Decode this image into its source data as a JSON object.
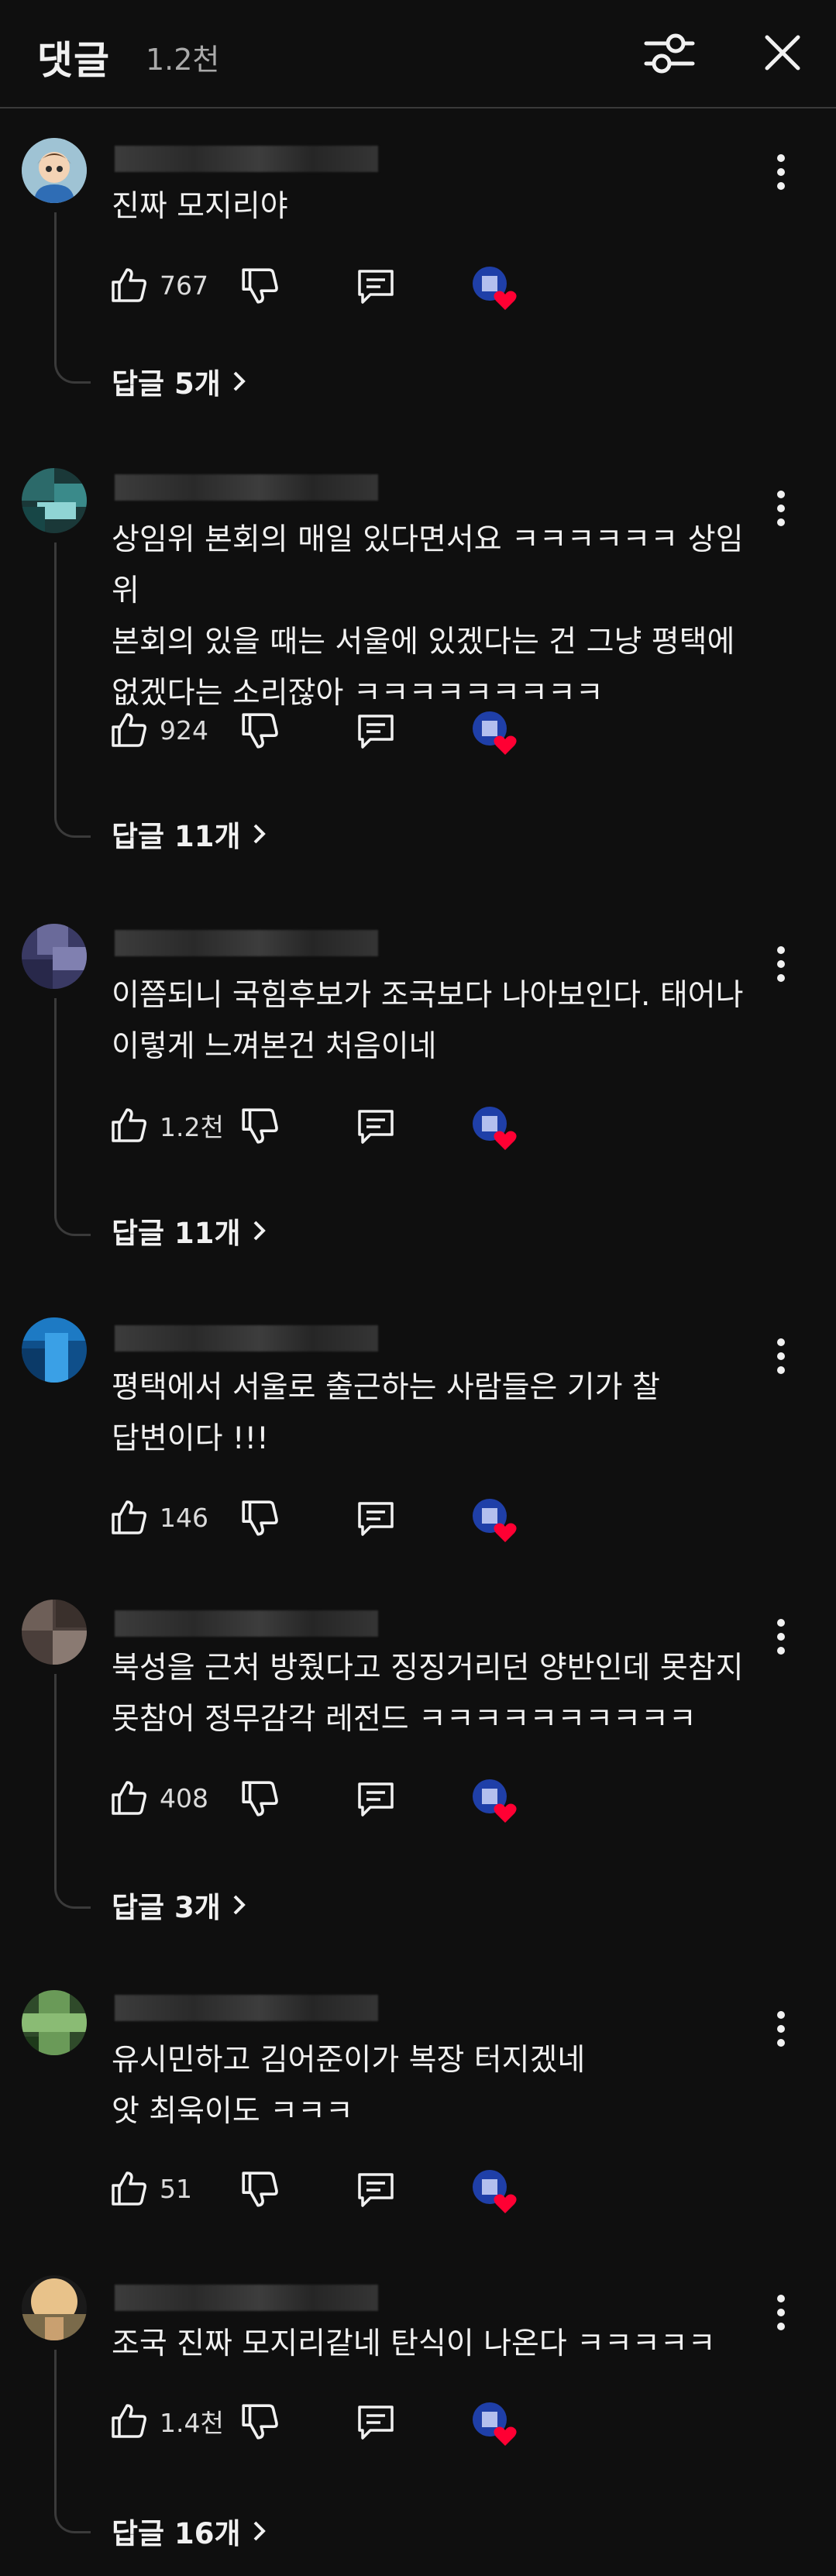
{
  "header": {
    "title": "댓글",
    "count": "1.2천"
  },
  "colors": {
    "background": "#0f0f0f",
    "text": "#f1f1f1",
    "muted": "#aaaaaa",
    "heart": "#ff0033",
    "badge": "#1f3fa8"
  },
  "comments": [
    {
      "text": "진짜 모지리야",
      "likes": "767",
      "replies": "답글 5개"
    },
    {
      "text": "상임위 본회의 매일 있다면서요 ㅋㅋㅋㅋㅋㅋ 상임위\n본회의 있을 때는 서울에 있겠다는 건 그냥 평택에\n없겠다는 소리잖아 ㅋㅋㅋㅋㅋㅋㅋㅋㅋ",
      "likes": "924",
      "replies": "답글 11개"
    },
    {
      "text": "이쯤되니 국힘후보가 조국보다 나아보인다. 태어나\n이렇게 느껴본건 처음이네",
      "likes": "1.2천",
      "replies": "답글 11개"
    },
    {
      "text": "평택에서 서울로 출근하는 사람들은 기가 찰\n답변이다 !!!",
      "likes": "146",
      "replies": ""
    },
    {
      "text": "북성을 근처 방줬다고 징징거리던 양반인데 못참지\n못참어 정무감각 레전드 ㅋㅋㅋㅋㅋㅋㅋㅋㅋㅋ",
      "likes": "408",
      "replies": "답글 3개"
    },
    {
      "text": "유시민하고 김어준이가 복장 터지겠네\n앗 최욱이도 ㅋㅋㅋ",
      "likes": "51",
      "replies": ""
    },
    {
      "text": "조국 진짜 모지리같네 탄식이 나온다 ㅋㅋㅋㅋㅋ",
      "likes": "1.4천",
      "replies": "답글 16개"
    }
  ]
}
